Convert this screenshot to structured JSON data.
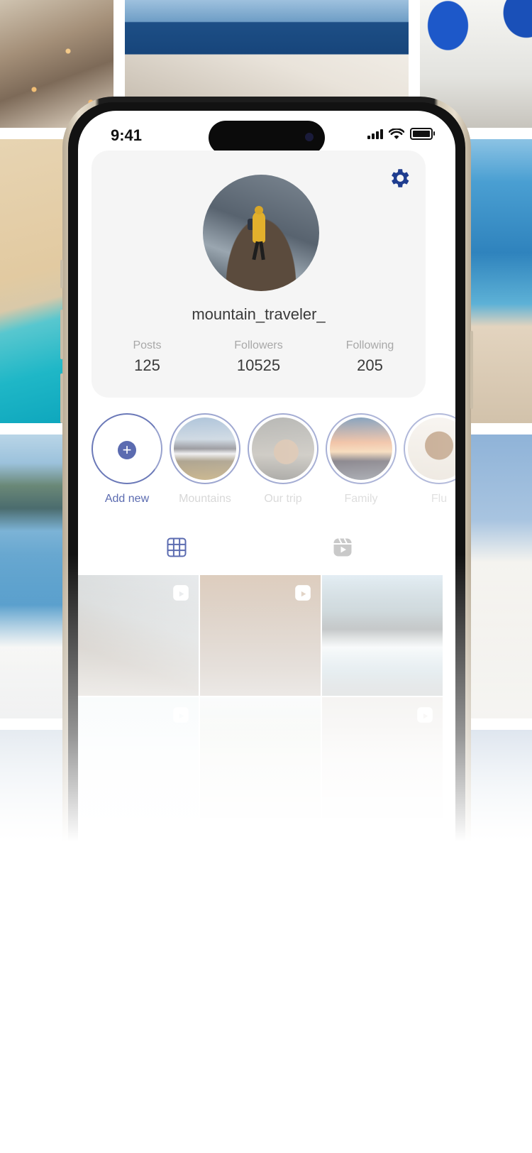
{
  "status_bar": {
    "time": "9:41"
  },
  "profile": {
    "username": "mountain_traveler_",
    "stats": [
      {
        "label": "Posts",
        "value": "125"
      },
      {
        "label": "Followers",
        "value": "10525"
      },
      {
        "label": "Following",
        "value": "205"
      }
    ]
  },
  "highlights": [
    {
      "label": "Add new"
    },
    {
      "label": "Mountains"
    },
    {
      "label": "Our trip"
    },
    {
      "label": "Family"
    },
    {
      "label": "Flu"
    }
  ],
  "icons": {
    "settings": "gear-icon",
    "grid_tab": "grid-icon",
    "reels_tab": "reels-icon",
    "add": "plus-icon"
  },
  "colors": {
    "accent": "#1f3d8f",
    "highlight_ring": "#6b79b8",
    "card_bg": "#f5f5f5"
  }
}
